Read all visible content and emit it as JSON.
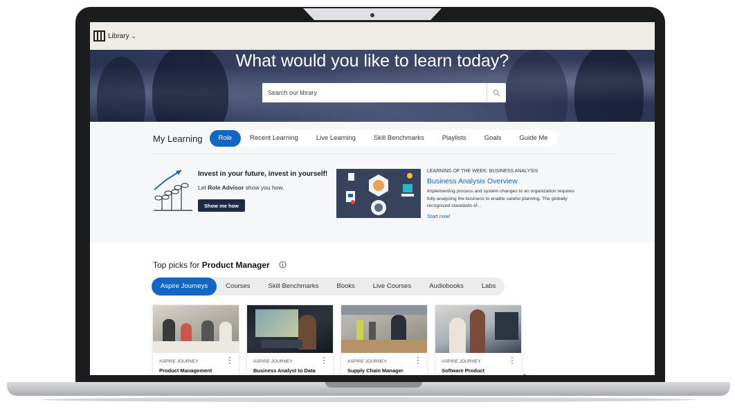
{
  "library": {
    "name": "Library",
    "chevron": "chevron-down-icon"
  },
  "hero": {
    "title": "What would you like to learn today?",
    "search_placeholder": "Search our library",
    "search_icon": "search-icon"
  },
  "my_learning": {
    "title": "My Learning",
    "tabs": [
      {
        "label": "Role",
        "active": true
      },
      {
        "label": "Recent Learning"
      },
      {
        "label": "Live Learning"
      },
      {
        "label": "Skill Benchmarks"
      },
      {
        "label": "Playlists"
      },
      {
        "label": "Goals"
      },
      {
        "label": "Guide Me"
      }
    ]
  },
  "invest": {
    "title": "Invest in your future, invest in yourself!",
    "sub_prefix": "Let ",
    "sub_bold": "Role Advisor",
    "sub_suffix": " show you how.",
    "button": "Show me how",
    "icon": "growth-plants-icon"
  },
  "lotw": {
    "label": "LEARNING OF THE WEEK: BUSINESS ANALYSIS",
    "title": "Business Analysis Overview",
    "description": "Implementing process and system changes to an organization requires fully analyzing the business to enable careful planning. The globally recognized standards of...",
    "cta": "Start now!"
  },
  "top_picks": {
    "prefix": "Top picks for ",
    "role": "Product Manager",
    "categories": [
      {
        "label": "Aspire Journeys",
        "active": true
      },
      {
        "label": "Courses"
      },
      {
        "label": "Skill Benchmarks"
      },
      {
        "label": "Books"
      },
      {
        "label": "Live Courses"
      },
      {
        "label": "Audiobooks"
      },
      {
        "label": "Labs"
      }
    ],
    "cards": [
      {
        "type": "ASPIRE JOURNEY",
        "title": "Product Management"
      },
      {
        "type": "ASPIRE JOURNEY",
        "title": "Business Analyst to Data"
      },
      {
        "type": "ASPIRE JOURNEY",
        "title": "Supply Chain Manager"
      },
      {
        "type": "ASPIRE JOURNEY",
        "title": "Software Product"
      }
    ]
  },
  "colors": {
    "accent": "#1267c4",
    "dark_button": "#1f2b42",
    "topbar": "#efece6",
    "hero": "#3a4463"
  }
}
